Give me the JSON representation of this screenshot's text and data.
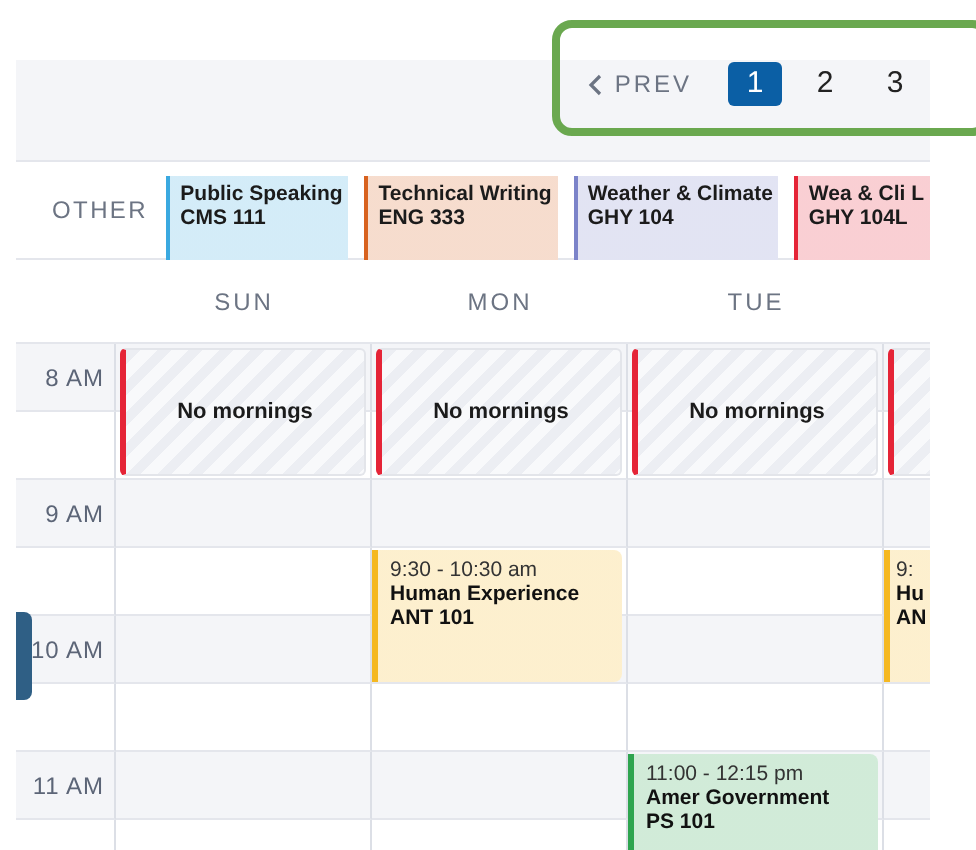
{
  "pagination": {
    "prev": {
      "label": "PREV"
    },
    "pages": [
      {
        "label": "1",
        "selected": true
      },
      {
        "label": "2",
        "selected": false
      },
      {
        "label": "3",
        "selected": false
      }
    ]
  },
  "other": {
    "label": "OTHER",
    "courses": [
      {
        "name": "Public Speaking",
        "code": "CMS 111",
        "color": "#3aa9e0"
      },
      {
        "name": "Technical Writing",
        "code": "ENG 333",
        "color": "#d8621f"
      },
      {
        "name": "Weather & Climate",
        "code": "GHY 104",
        "color": "#7b83c9"
      },
      {
        "name": "Wea & Cli L",
        "code": "GHY 104L",
        "color": "#e52437"
      }
    ]
  },
  "days": [
    "SUN",
    "MON",
    "TUE"
  ],
  "times": [
    "8 AM",
    "9 AM",
    "10 AM",
    "11 AM"
  ],
  "columns": [
    {
      "events": [
        {
          "kind": "blocked",
          "label": "No mornings",
          "color": "#e52437"
        }
      ]
    },
    {
      "events": [
        {
          "kind": "blocked",
          "label": "No mornings",
          "color": "#e52437"
        },
        {
          "kind": "class",
          "time": "9:30 - 10:30 am",
          "name": "Human Experience",
          "code": "ANT 101",
          "color": "#f5b821"
        }
      ]
    },
    {
      "events": [
        {
          "kind": "blocked",
          "label": "No mornings",
          "color": "#e52437"
        },
        {
          "kind": "class",
          "time": "11:00 - 12:15 pm",
          "name": "Amer Government",
          "code": "PS 101",
          "color": "#2ea44f"
        }
      ]
    },
    {
      "events": [
        {
          "kind": "blocked",
          "color": "#e52437"
        },
        {
          "kind": "class",
          "time": "9:",
          "name": "Hu",
          "code": "AN",
          "color": "#f5b821"
        }
      ]
    }
  ]
}
